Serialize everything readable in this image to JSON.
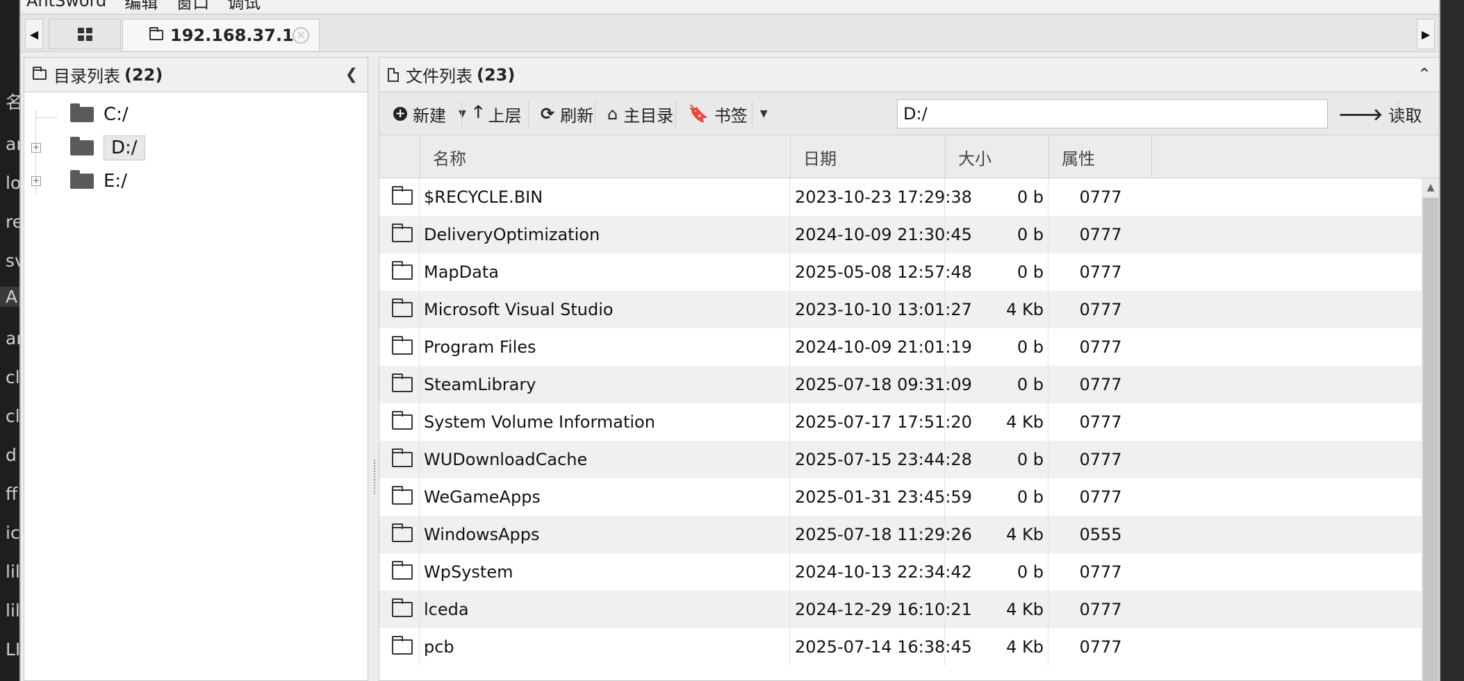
{
  "background_strip": [
    "名称",
    "ar",
    "lo",
    "re",
    "sv",
    "A",
    "ar",
    "cl",
    "cl",
    "d",
    "ff",
    "ic",
    "lil",
    "lil",
    "LI"
  ],
  "menubar": [
    "AntSword",
    "编辑",
    "窗口",
    "调试"
  ],
  "tab": {
    "title": "192.168.37.1"
  },
  "dir_panel": {
    "title": "目录列表",
    "count": "(22)",
    "items": [
      {
        "label": "C:/"
      },
      {
        "label": "D:/"
      },
      {
        "label": "E:/"
      }
    ]
  },
  "file_panel": {
    "title": "文件列表",
    "count": "(23)",
    "toolbar": {
      "new": "新建",
      "up": "上层",
      "refresh": "刷新",
      "home": "主目录",
      "bookmark": "书签",
      "path": "D:/",
      "read": "读取"
    },
    "columns": {
      "name": "名称",
      "date": "日期",
      "size": "大小",
      "attr": "属性"
    },
    "rows": [
      {
        "name": "$RECYCLE.BIN",
        "date": "2023-10-23 17:29:38",
        "size": "0 b",
        "attr": "0777"
      },
      {
        "name": "DeliveryOptimization",
        "date": "2024-10-09 21:30:45",
        "size": "0 b",
        "attr": "0777"
      },
      {
        "name": "MapData",
        "date": "2025-05-08 12:57:48",
        "size": "0 b",
        "attr": "0777"
      },
      {
        "name": "Microsoft Visual Studio",
        "date": "2023-10-10 13:01:27",
        "size": "4 Kb",
        "attr": "0777"
      },
      {
        "name": "Program Files",
        "date": "2024-10-09 21:01:19",
        "size": "0 b",
        "attr": "0777"
      },
      {
        "name": "SteamLibrary",
        "date": "2025-07-18 09:31:09",
        "size": "0 b",
        "attr": "0777"
      },
      {
        "name": "System Volume Information",
        "date": "2025-07-17 17:51:20",
        "size": "4 Kb",
        "attr": "0777"
      },
      {
        "name": "WUDownloadCache",
        "date": "2025-07-15 23:44:28",
        "size": "0 b",
        "attr": "0777"
      },
      {
        "name": "WeGameApps",
        "date": "2025-01-31 23:45:59",
        "size": "0 b",
        "attr": "0777"
      },
      {
        "name": "WindowsApps",
        "date": "2025-07-18 11:29:26",
        "size": "4 Kb",
        "attr": "0555"
      },
      {
        "name": "WpSystem",
        "date": "2024-10-13 22:34:42",
        "size": "0 b",
        "attr": "0777"
      },
      {
        "name": "lceda",
        "date": "2024-12-29 16:10:21",
        "size": "4 Kb",
        "attr": "0777"
      },
      {
        "name": "pcb",
        "date": "2025-07-14 16:38:45",
        "size": "4 Kb",
        "attr": "0777"
      }
    ]
  }
}
